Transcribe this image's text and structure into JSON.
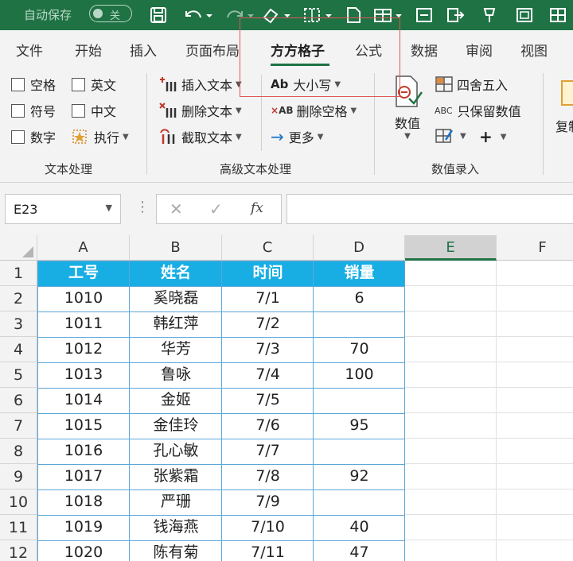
{
  "titlebar": {
    "autosave_label": "自动保存",
    "autosave_state": "关"
  },
  "tabs": [
    {
      "label": "文件"
    },
    {
      "label": "开始"
    },
    {
      "label": "插入"
    },
    {
      "label": "页面布局"
    },
    {
      "label": "方方格子"
    },
    {
      "label": "公式"
    },
    {
      "label": "数据"
    },
    {
      "label": "审阅"
    },
    {
      "label": "视图"
    }
  ],
  "ribbon": {
    "text_group": {
      "label": "文本处理",
      "checkboxes": [
        "空格",
        "英文",
        "符号",
        "中文",
        "数字"
      ],
      "execute": "执行"
    },
    "advanced_group": {
      "label": "高级文本处理",
      "insert_text": "插入文本",
      "delete_text": "删除文本",
      "extract_text": "截取文本",
      "case": "大小写",
      "delete_space": "删除空格",
      "more": "更多"
    },
    "number_group": {
      "label": "数值录入",
      "number": "数值",
      "round": "四舍五入",
      "keep_value": "只保留数值"
    },
    "partial_label": "复制"
  },
  "formula_bar": {
    "name_box": "E23",
    "fx": "fx",
    "value": ""
  },
  "sheet": {
    "columns": [
      "A",
      "B",
      "C",
      "D",
      "E",
      "F"
    ],
    "selected_column": "E",
    "rows": [
      "1",
      "2",
      "3",
      "4",
      "5",
      "6",
      "7",
      "8",
      "9",
      "10",
      "11",
      "12"
    ],
    "headers": [
      "工号",
      "姓名",
      "时间",
      "销量"
    ],
    "data": [
      [
        "1010",
        "奚晓磊",
        "7/1",
        "6"
      ],
      [
        "1011",
        "韩红萍",
        "7/2",
        ""
      ],
      [
        "1012",
        "华芳",
        "7/3",
        "70"
      ],
      [
        "1013",
        "鲁咏",
        "7/4",
        "100"
      ],
      [
        "1014",
        "金姬",
        "7/5",
        ""
      ],
      [
        "1015",
        "金佳玲",
        "7/6",
        "95"
      ],
      [
        "1016",
        "孔心敏",
        "7/7",
        ""
      ],
      [
        "1017",
        "张紫霜",
        "7/8",
        "92"
      ],
      [
        "1018",
        "严珊",
        "7/9",
        ""
      ],
      [
        "1019",
        "钱海燕",
        "7/10",
        "40"
      ],
      [
        "1020",
        "陈有菊",
        "7/11",
        "47"
      ]
    ]
  },
  "colors": {
    "accent": "#1f7244",
    "table_header": "#18aee4",
    "table_border": "#5aa7d9",
    "annotation": "#e05656"
  }
}
